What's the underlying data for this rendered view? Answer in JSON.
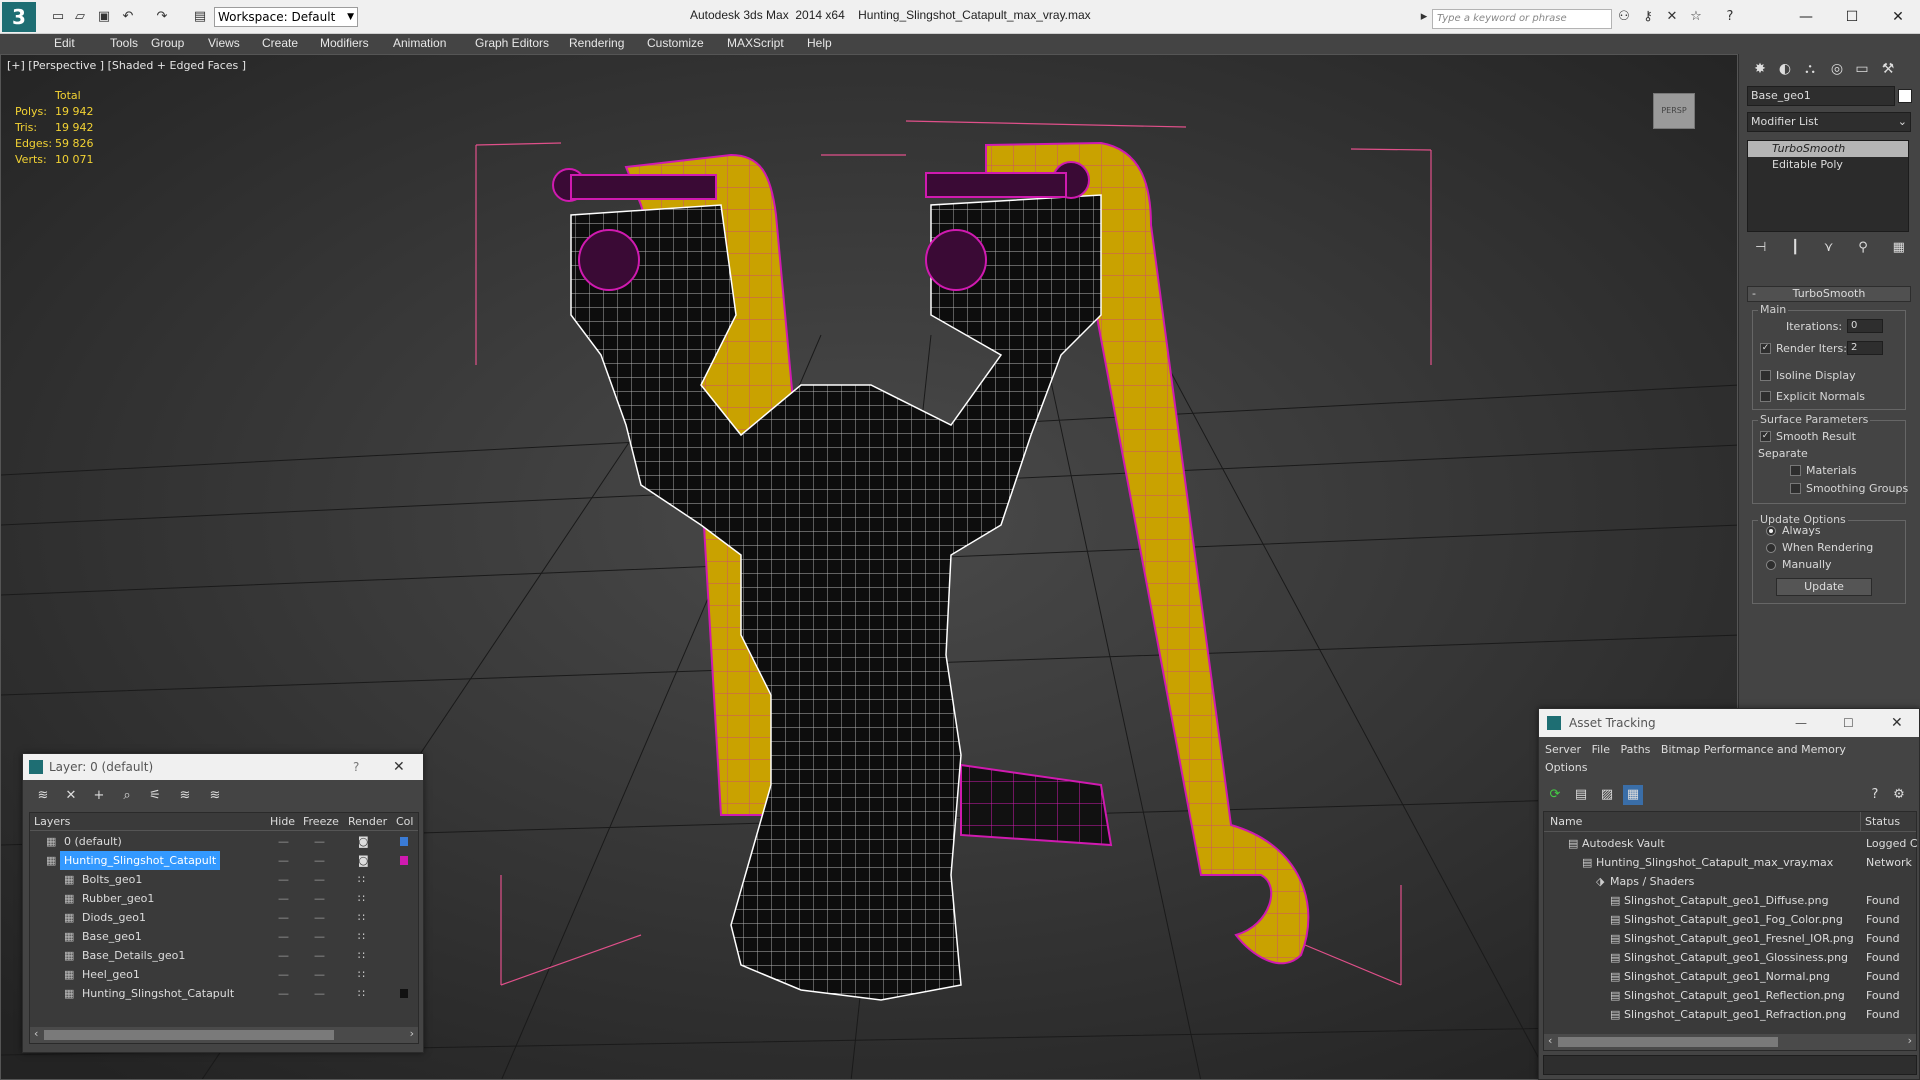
{
  "titlebar": {
    "app_name": "Autodesk 3ds Max  2014 x64",
    "file_name": "Hunting_Slingshot_Catapult_max_vray.max",
    "workspace": "Workspace: Default",
    "search_placeholder": "Type a keyword or phrase"
  },
  "menu": [
    "Edit",
    "Tools",
    "Group",
    "Views",
    "Create",
    "Modifiers",
    "Animation",
    "Graph Editors",
    "Rendering",
    "Customize",
    "MAXScript",
    "Help"
  ],
  "viewport": {
    "label": "[+] [Perspective ] [Shaded + Edged Faces ]",
    "stats_header": "Total",
    "stats": [
      {
        "k": "Polys:",
        "v": "19 942"
      },
      {
        "k": "Tris:",
        "v": "19 942"
      },
      {
        "k": "Edges:",
        "v": "59 826"
      },
      {
        "k": "Verts:",
        "v": "10 071"
      }
    ],
    "viewcube_label": "PERSP"
  },
  "command_panel": {
    "object_name": "Base_geo1",
    "modifier_list": "Modifier List",
    "stack": [
      "TurboSmooth",
      "Editable Poly"
    ],
    "rollout_title": "TurboSmooth",
    "main_label": "Main",
    "iterations_label": "Iterations:",
    "iterations_value": "0",
    "render_iters_label": "Render Iters:",
    "render_iters_value": "2",
    "isoline": "Isoline Display",
    "explicit_normals": "Explicit Normals",
    "surface_params": "Surface Parameters",
    "smooth_result": "Smooth Result",
    "separate": "Separate",
    "materials": "Materials",
    "smoothing_groups": "Smoothing Groups",
    "update_options": "Update Options",
    "always": "Always",
    "when_rendering": "When Rendering",
    "manually": "Manually",
    "update_button": "Update"
  },
  "layer_panel": {
    "title": "Layer: 0 (default)",
    "help": "?",
    "columns": [
      "Layers",
      "Hide",
      "Freeze",
      "Render",
      "Col"
    ],
    "rows": [
      {
        "name": "0 (default)",
        "indent": 0,
        "color": "#3a7bd5",
        "selected": false
      },
      {
        "name": "Hunting_Slingshot_Catapult",
        "indent": 0,
        "color": "#d01ab0",
        "selected": true
      },
      {
        "name": "Bolts_geo1",
        "indent": 1,
        "color": "",
        "selected": false
      },
      {
        "name": "Rubber_geo1",
        "indent": 1,
        "color": "",
        "selected": false
      },
      {
        "name": "Diods_geo1",
        "indent": 1,
        "color": "",
        "selected": false
      },
      {
        "name": "Base_geo1",
        "indent": 1,
        "color": "",
        "selected": false
      },
      {
        "name": "Base_Details_geo1",
        "indent": 1,
        "color": "",
        "selected": false
      },
      {
        "name": "Heel_geo1",
        "indent": 1,
        "color": "",
        "selected": false
      },
      {
        "name": "Hunting_Slingshot_Catapult",
        "indent": 1,
        "color": "#111111",
        "selected": false
      }
    ]
  },
  "asset_tracking": {
    "title": "Asset Tracking",
    "menu": [
      "Server",
      "File",
      "Paths",
      "Bitmap Performance and Memory",
      "Options"
    ],
    "col_name": "Name",
    "col_status": "Status",
    "rows": [
      {
        "name": "Autodesk Vault",
        "indent": 1,
        "status": "Logged C"
      },
      {
        "name": "Hunting_Slingshot_Catapult_max_vray.max",
        "indent": 2,
        "status": "Network"
      },
      {
        "name": "Maps / Shaders",
        "indent": 3,
        "status": ""
      },
      {
        "name": "Slingshot_Catapult_geo1_Diffuse.png",
        "indent": 4,
        "status": "Found"
      },
      {
        "name": "Slingshot_Catapult_geo1_Fog_Color.png",
        "indent": 4,
        "status": "Found"
      },
      {
        "name": "Slingshot_Catapult_geo1_Fresnel_IOR.png",
        "indent": 4,
        "status": "Found"
      },
      {
        "name": "Slingshot_Catapult_geo1_Glossiness.png",
        "indent": 4,
        "status": "Found"
      },
      {
        "name": "Slingshot_Catapult_geo1_Normal.png",
        "indent": 4,
        "status": "Found"
      },
      {
        "name": "Slingshot_Catapult_geo1_Reflection.png",
        "indent": 4,
        "status": "Found"
      },
      {
        "name": "Slingshot_Catapult_geo1_Refraction.png",
        "indent": 4,
        "status": "Found"
      }
    ]
  },
  "colors": {
    "accent": "#3399ff",
    "stats": "#f2d233",
    "wire": "#d01ab0",
    "band": "#c9a200"
  }
}
